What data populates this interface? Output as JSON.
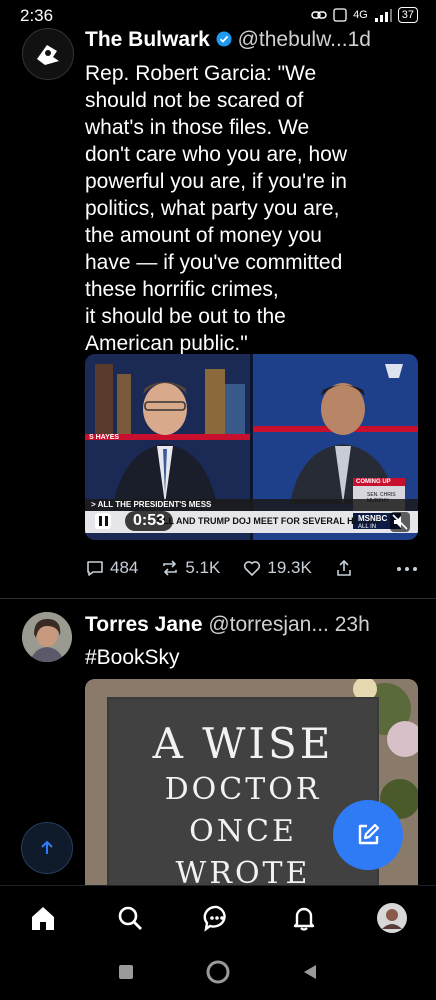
{
  "status_bar": {
    "time": "2:36",
    "network": "4G",
    "battery": "37"
  },
  "posts": [
    {
      "author": "The Bulwark",
      "handle": "@thebulw...",
      "time": "1d",
      "text_lines": [
        "Rep. Robert Garcia: \"We",
        "should not be scared of",
        "what's in those files. We",
        "don't care who you are, how",
        "powerful you are, if you're in",
        "politics, what party you are,",
        "the amount of money you",
        "have — if you've committed",
        "these horrific crimes,",
        "it should be out to the",
        "American public.\""
      ],
      "video": {
        "chyron_top": "> ALL THE PRESIDENT'S MESS",
        "chyron_main": "ELL AND TRUMP DOJ MEET FOR SEVERAL HOURS",
        "duration": "0:53",
        "network": "MSNBC",
        "coming_up": "COMING UP",
        "coming_up_name": "SEN. CHRIS MURPHY",
        "left_tag": "S HAYES",
        "all_in": "ALL IN"
      },
      "replies": "484",
      "reposts": "5.1K",
      "likes": "19.3K"
    },
    {
      "author": "Torres Jane",
      "handle": "@torresjan...",
      "time": "23h",
      "text_lines": [
        "#BookSky"
      ],
      "image_text": [
        "A WISE",
        "DOCTOR",
        "ONCE",
        "WROTE"
      ]
    }
  ],
  "colors": {
    "accent": "#2f7bf6",
    "verified": "#1d9bf0",
    "background": "#000000"
  }
}
